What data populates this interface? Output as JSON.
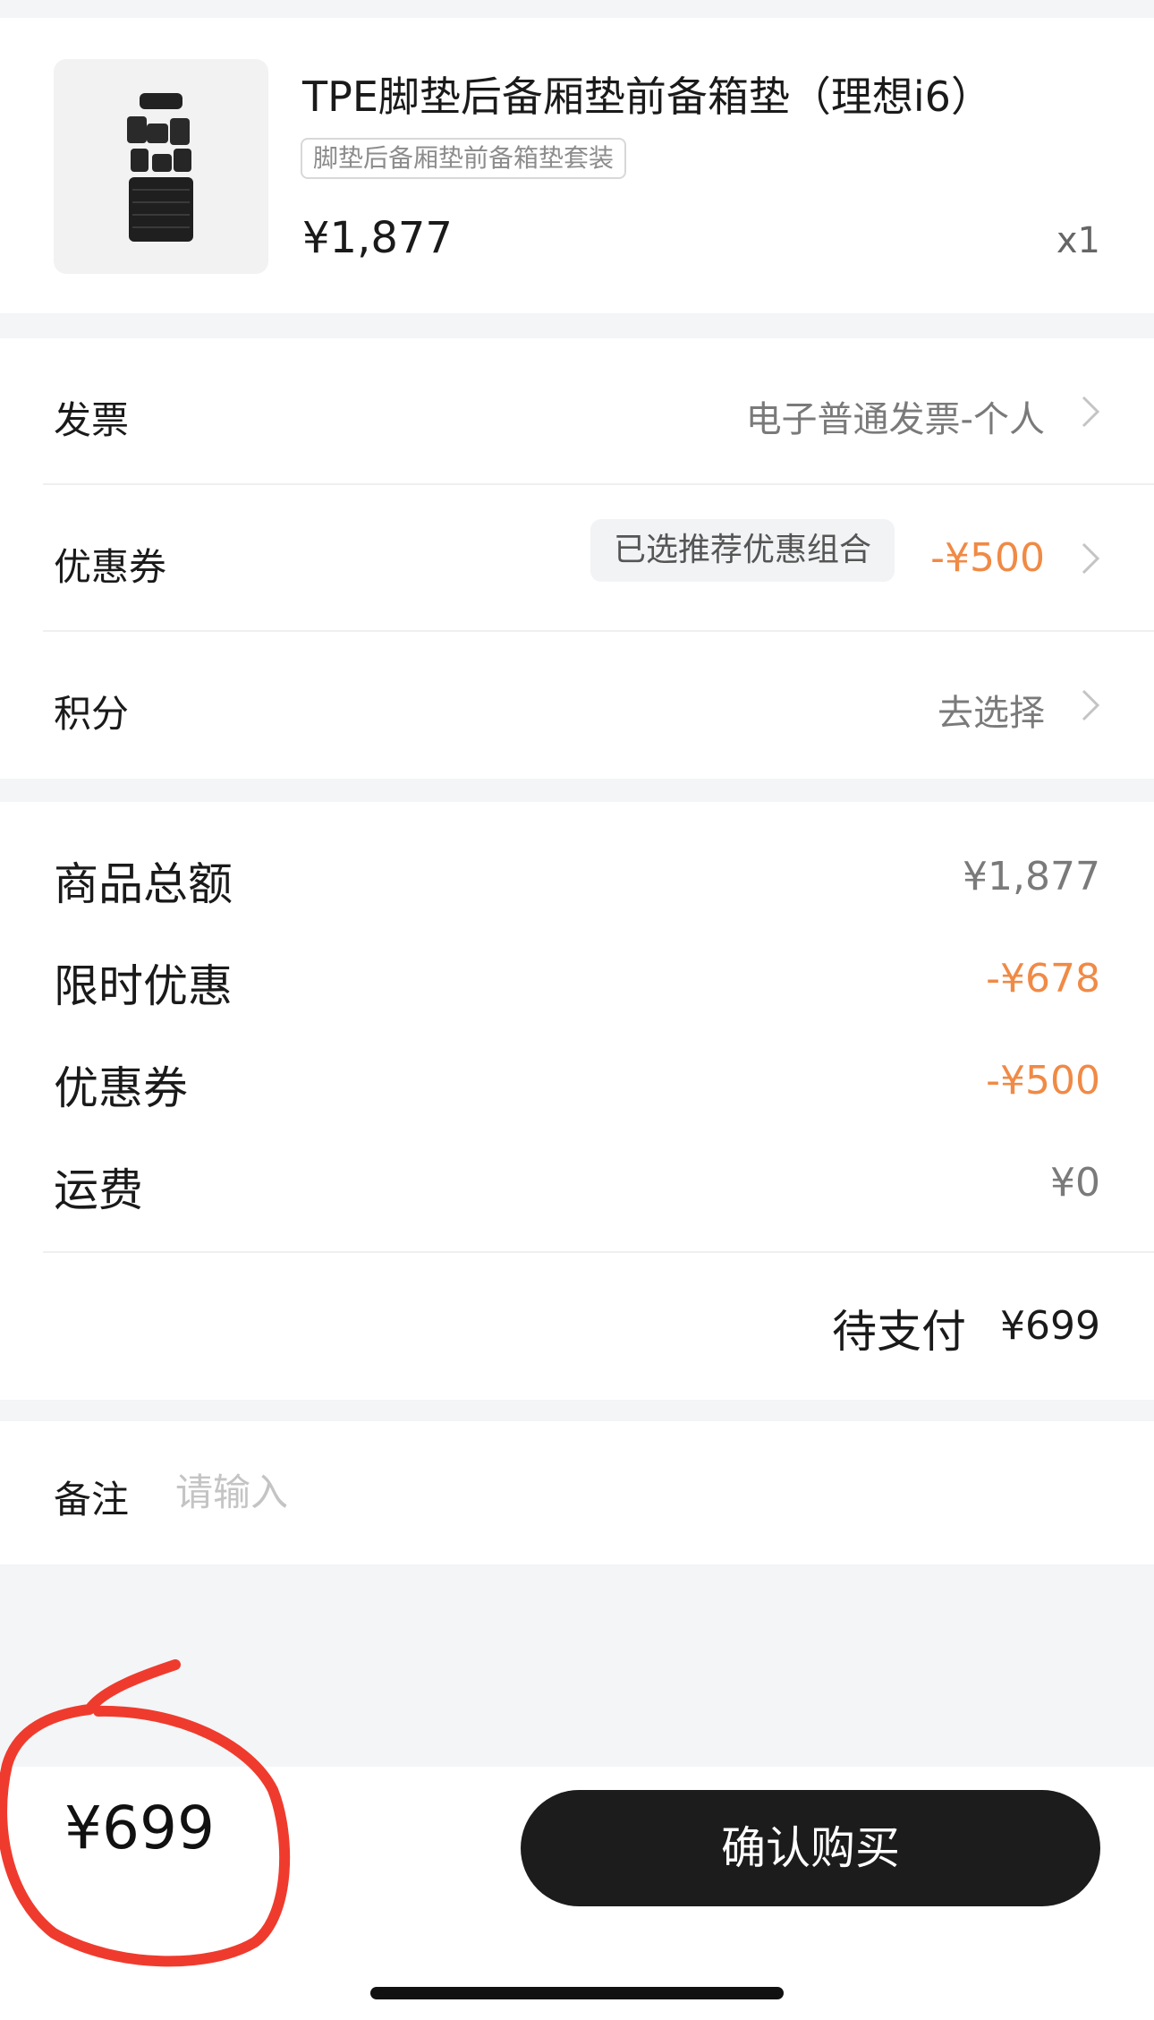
{
  "product": {
    "title": "TPE脚垫后备厢垫前备箱垫（理想i6）",
    "tag": "脚垫后备厢垫前备箱垫套装",
    "price": "¥1,877",
    "quantity": "x1",
    "image_icon": "floor-mat-set-icon"
  },
  "options": {
    "invoice": {
      "label": "发票",
      "value": "电子普通发票-个人"
    },
    "coupon": {
      "label": "优惠券",
      "pill": "已选推荐优惠组合",
      "amount": "-¥500"
    },
    "points": {
      "label": "积分",
      "value": "去选择"
    }
  },
  "summary": {
    "rows": [
      {
        "label": "商品总额",
        "value": "¥1,877"
      },
      {
        "label": "限时优惠",
        "value": "-¥678"
      },
      {
        "label": "优惠券",
        "value": "-¥500"
      },
      {
        "label": "运费",
        "value": "¥0"
      }
    ],
    "due_label": "待支付",
    "due_value": "¥699"
  },
  "remark": {
    "label": "备注",
    "placeholder": "请输入",
    "value": ""
  },
  "footer": {
    "total": "¥699",
    "buy_label": "确认购买"
  },
  "colors": {
    "accent_orange": "#f08a45",
    "button_dark": "#1c1c1c",
    "annotation_red": "#ef3b2d",
    "page_bg": "#f4f5f7"
  }
}
